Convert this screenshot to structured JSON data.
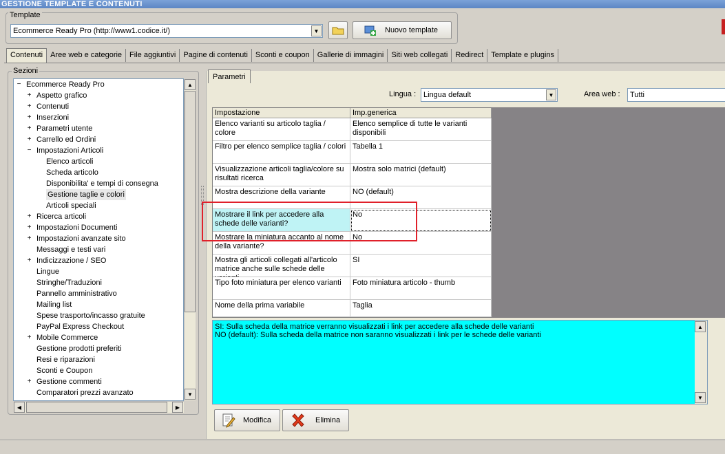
{
  "window": {
    "title": "GESTIONE TEMPLATE E CONTENUTI"
  },
  "template": {
    "legend": "Template",
    "selected": "Ecommerce Ready Pro (http://www1.codice.it/)",
    "new_button": "Nuovo template"
  },
  "tabs": [
    "Contenuti",
    "Aree web e categorie",
    "File aggiuntivi",
    "Pagine di contenuti",
    "Sconti e coupon",
    "Gallerie di immagini",
    "Siti web collegati",
    "Redirect",
    "Template e plugins"
  ],
  "sections": {
    "legend": "Sezioni",
    "tree": [
      {
        "label": "Ecommerce Ready Pro",
        "level": 0,
        "expander": "−"
      },
      {
        "label": "Aspetto grafico",
        "level": 1,
        "expander": "+"
      },
      {
        "label": "Contenuti",
        "level": 1,
        "expander": "+"
      },
      {
        "label": "Inserzioni",
        "level": 1,
        "expander": "+"
      },
      {
        "label": "Parametri utente",
        "level": 1,
        "expander": "+"
      },
      {
        "label": "Carrello ed Ordini",
        "level": 1,
        "expander": "+"
      },
      {
        "label": "Impostazioni Articoli",
        "level": 1,
        "expander": "−"
      },
      {
        "label": "Elenco articoli",
        "level": 2,
        "expander": ""
      },
      {
        "label": "Scheda articolo",
        "level": 2,
        "expander": ""
      },
      {
        "label": "Disponibilita' e tempi di consegna",
        "level": 2,
        "expander": ""
      },
      {
        "label": "Gestione taglie e colori",
        "level": 2,
        "expander": "",
        "selected": true
      },
      {
        "label": "Articoli speciali",
        "level": 2,
        "expander": ""
      },
      {
        "label": "Ricerca articoli",
        "level": 1,
        "expander": "+"
      },
      {
        "label": "Impostazioni Documenti",
        "level": 1,
        "expander": "+"
      },
      {
        "label": "Impostazioni avanzate sito",
        "level": 1,
        "expander": "+"
      },
      {
        "label": "Messaggi e testi vari",
        "level": 1,
        "expander": ""
      },
      {
        "label": "Indicizzazione / SEO",
        "level": 1,
        "expander": "+"
      },
      {
        "label": "Lingue",
        "level": 1,
        "expander": ""
      },
      {
        "label": "Stringhe/Traduzioni",
        "level": 1,
        "expander": ""
      },
      {
        "label": "Pannello amministrativo",
        "level": 1,
        "expander": ""
      },
      {
        "label": "Mailing list",
        "level": 1,
        "expander": ""
      },
      {
        "label": "Spese trasporto/incasso gratuite",
        "level": 1,
        "expander": ""
      },
      {
        "label": "PayPal Express Checkout",
        "level": 1,
        "expander": ""
      },
      {
        "label": "Mobile Commerce",
        "level": 1,
        "expander": "+"
      },
      {
        "label": "Gestione prodotti preferiti",
        "level": 1,
        "expander": ""
      },
      {
        "label": "Resi e riparazioni",
        "level": 1,
        "expander": ""
      },
      {
        "label": "Sconti e Coupon",
        "level": 1,
        "expander": ""
      },
      {
        "label": "Gestione commenti",
        "level": 1,
        "expander": "+"
      },
      {
        "label": "Comparatori prezzi avanzato",
        "level": 1,
        "expander": ""
      }
    ]
  },
  "params": {
    "tab": "Parametri",
    "lingua_label": "Lingua :",
    "lingua_value": "Lingua default",
    "area_label": "Area web :",
    "area_value": "Tutti",
    "headers": [
      "Impostazione",
      "Imp.generica"
    ],
    "rows": [
      {
        "setting": "Elenco varianti su articolo taglia / colore",
        "value": "Elenco semplice di tutte le varianti disponibili"
      },
      {
        "setting": "Filtro per elenco semplice taglia / colori",
        "value": "Tabella 1"
      },
      {
        "setting": "Visualizzazione articoli taglia/colore su risultati ricerca",
        "value": "Mostra solo matrici (default)"
      },
      {
        "setting": "Mostra descrizione della variante",
        "value": "NO (default)"
      },
      {
        "setting": "Mostrare il link per accedere alla schede delle varianti?",
        "value": "No",
        "selected": true
      },
      {
        "setting": "Mostrare la miniatura accanto al nome della variante?",
        "value": "No"
      },
      {
        "setting": "Mostra gli articoli collegati all'articolo matrice anche sulle schede delle varianti",
        "value": "SI"
      },
      {
        "setting": "Tipo foto miniatura per elenco varianti",
        "value": "Foto miniatura articolo - thumb"
      },
      {
        "setting": "Nome della prima variabile",
        "value": "Taglia"
      }
    ],
    "description_lines": [
      "SI: Sulla scheda della matrice verranno visualizzati i link per accedere alla schede delle varianti",
      "NO (default): Sulla scheda della matrice non saranno visualizzati i link per le schede delle varianti"
    ],
    "modify_button": "Modifica",
    "delete_button": "Elimina"
  },
  "colors": {
    "selection": "#bff3f5",
    "description_bg": "#00ffff",
    "highlight": "#e0202a"
  }
}
